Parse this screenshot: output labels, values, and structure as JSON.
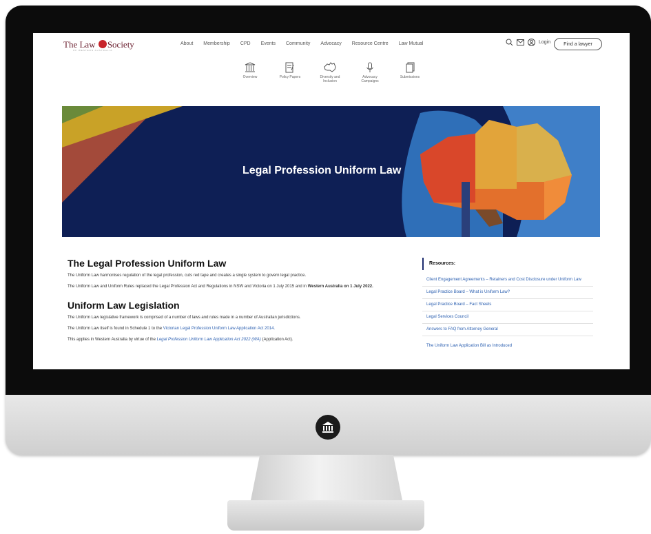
{
  "site": {
    "logo_text_left": "The Law",
    "logo_text_right": "Society",
    "logo_subtext": "OF WESTERN AUSTRALIA"
  },
  "nav": {
    "links": [
      "About",
      "Membership",
      "CPD",
      "Events",
      "Community",
      "Advocacy",
      "Resource Centre",
      "Law Mutual"
    ],
    "login_label": "Login",
    "find_lawyer_label": "Find a lawyer"
  },
  "subnav": [
    {
      "label": "Overview",
      "icon": "columns-icon"
    },
    {
      "label": "Policy Papers",
      "icon": "document-pen-icon"
    },
    {
      "label": "Diversity and Inclusion",
      "icon": "australia-map-icon"
    },
    {
      "label": "Advocacy Campaigns",
      "icon": "microphone-icon"
    },
    {
      "label": "Submissions",
      "icon": "pages-icon"
    }
  ],
  "hero": {
    "title": "Legal Profession Uniform Law"
  },
  "content": {
    "heading1": "The Legal Profession Uniform Law",
    "para1": "The Uniform Law harmonises regulation of the legal profession, cuts red tape and creates a single system to govern legal practice.",
    "para2_start": "The Uniform Law and Uniform Rules replaced the Legal Profession Act and Regulations in NSW and Victoria on 1 July 2015 and in ",
    "para2_bold": "Western Australia on 1 July 2022.",
    "heading2": "Uniform Law Legislation",
    "para3": "The Uniform Law legislative framework is comprised of a number of laws and rules made in a number of Australian jurisdictions.",
    "para4_start": "The Uniform Law itself is found in Schedule 1 to the ",
    "para4_link": "Victorian Legal Profession Uniform Law Application Act 2014.",
    "para5_start": "This applies in Western Australia by virtue of the ",
    "para5_link": "Legal Profession Uniform Law Application Act 2022 (WA)",
    "para5_end": " (Application Act)."
  },
  "resources": {
    "title": "Resources:",
    "items": [
      "Client Engagement Agreements – Retainers and Cost Disclosure under Uniform Law",
      "Legal Practice Board – What is Uniform Law?",
      "Legal Practice Board – Fact Sheets",
      "Legal Services Council",
      "Answers to FAQ from Attorney General",
      "The Uniform Law Application Bill as Introduced"
    ]
  },
  "colors": {
    "hero_bg": "#0e1f55",
    "link": "#2b5fb0",
    "logo": "#6b2030",
    "accent_red": "#c8242a"
  }
}
